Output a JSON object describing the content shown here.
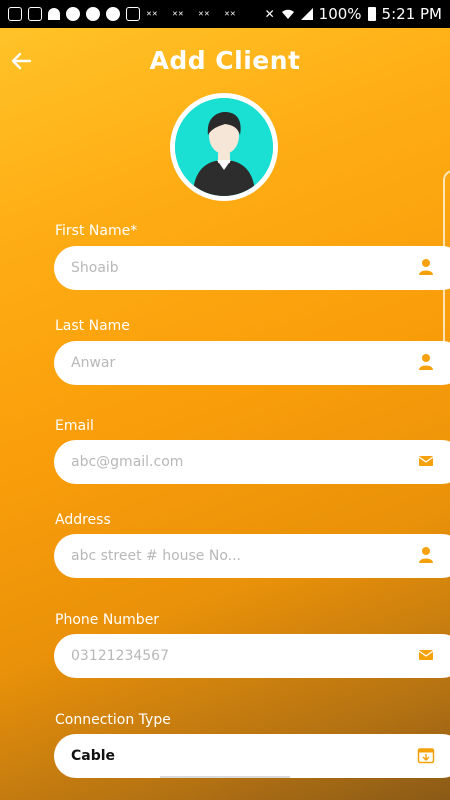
{
  "status_bar": {
    "battery": "100%",
    "time": "5:21 PM",
    "left_icons": [
      "chat-icon",
      "monitor-icon",
      "wifi-icon",
      "facebook-icon",
      "facebook-icon",
      "facebook-icon",
      "image-icon",
      "news-icon",
      "news-icon",
      "news-icon",
      "news-icon",
      "news-icon"
    ],
    "right_icons": [
      "mute-icon",
      "wifi-icon",
      "signal-icon",
      "battery-icon"
    ]
  },
  "header": {
    "back_icon": "arrow-left-icon",
    "title": "Add Client"
  },
  "avatar": {
    "icon": "user-avatar-icon",
    "bg_color": "#19e0d2"
  },
  "accent_color": "#f5a10c",
  "form": {
    "first_name": {
      "label": "First Name*",
      "placeholder": "Shoaib",
      "icon": "person-icon"
    },
    "last_name": {
      "label": "Last Name",
      "placeholder": "Anwar",
      "icon": "person-icon"
    },
    "email": {
      "label": "Email",
      "placeholder": "abc@gmail.com",
      "icon": "mail-icon"
    },
    "address": {
      "label": "Address",
      "placeholder": "abc street # house No...",
      "icon": "person-icon"
    },
    "phone": {
      "label": "Phone Number",
      "placeholder": "03121234567",
      "icon": "mail-icon"
    },
    "connection_type": {
      "label": "Connection Type",
      "value": "Cable",
      "icon": "calendar-icon"
    }
  }
}
